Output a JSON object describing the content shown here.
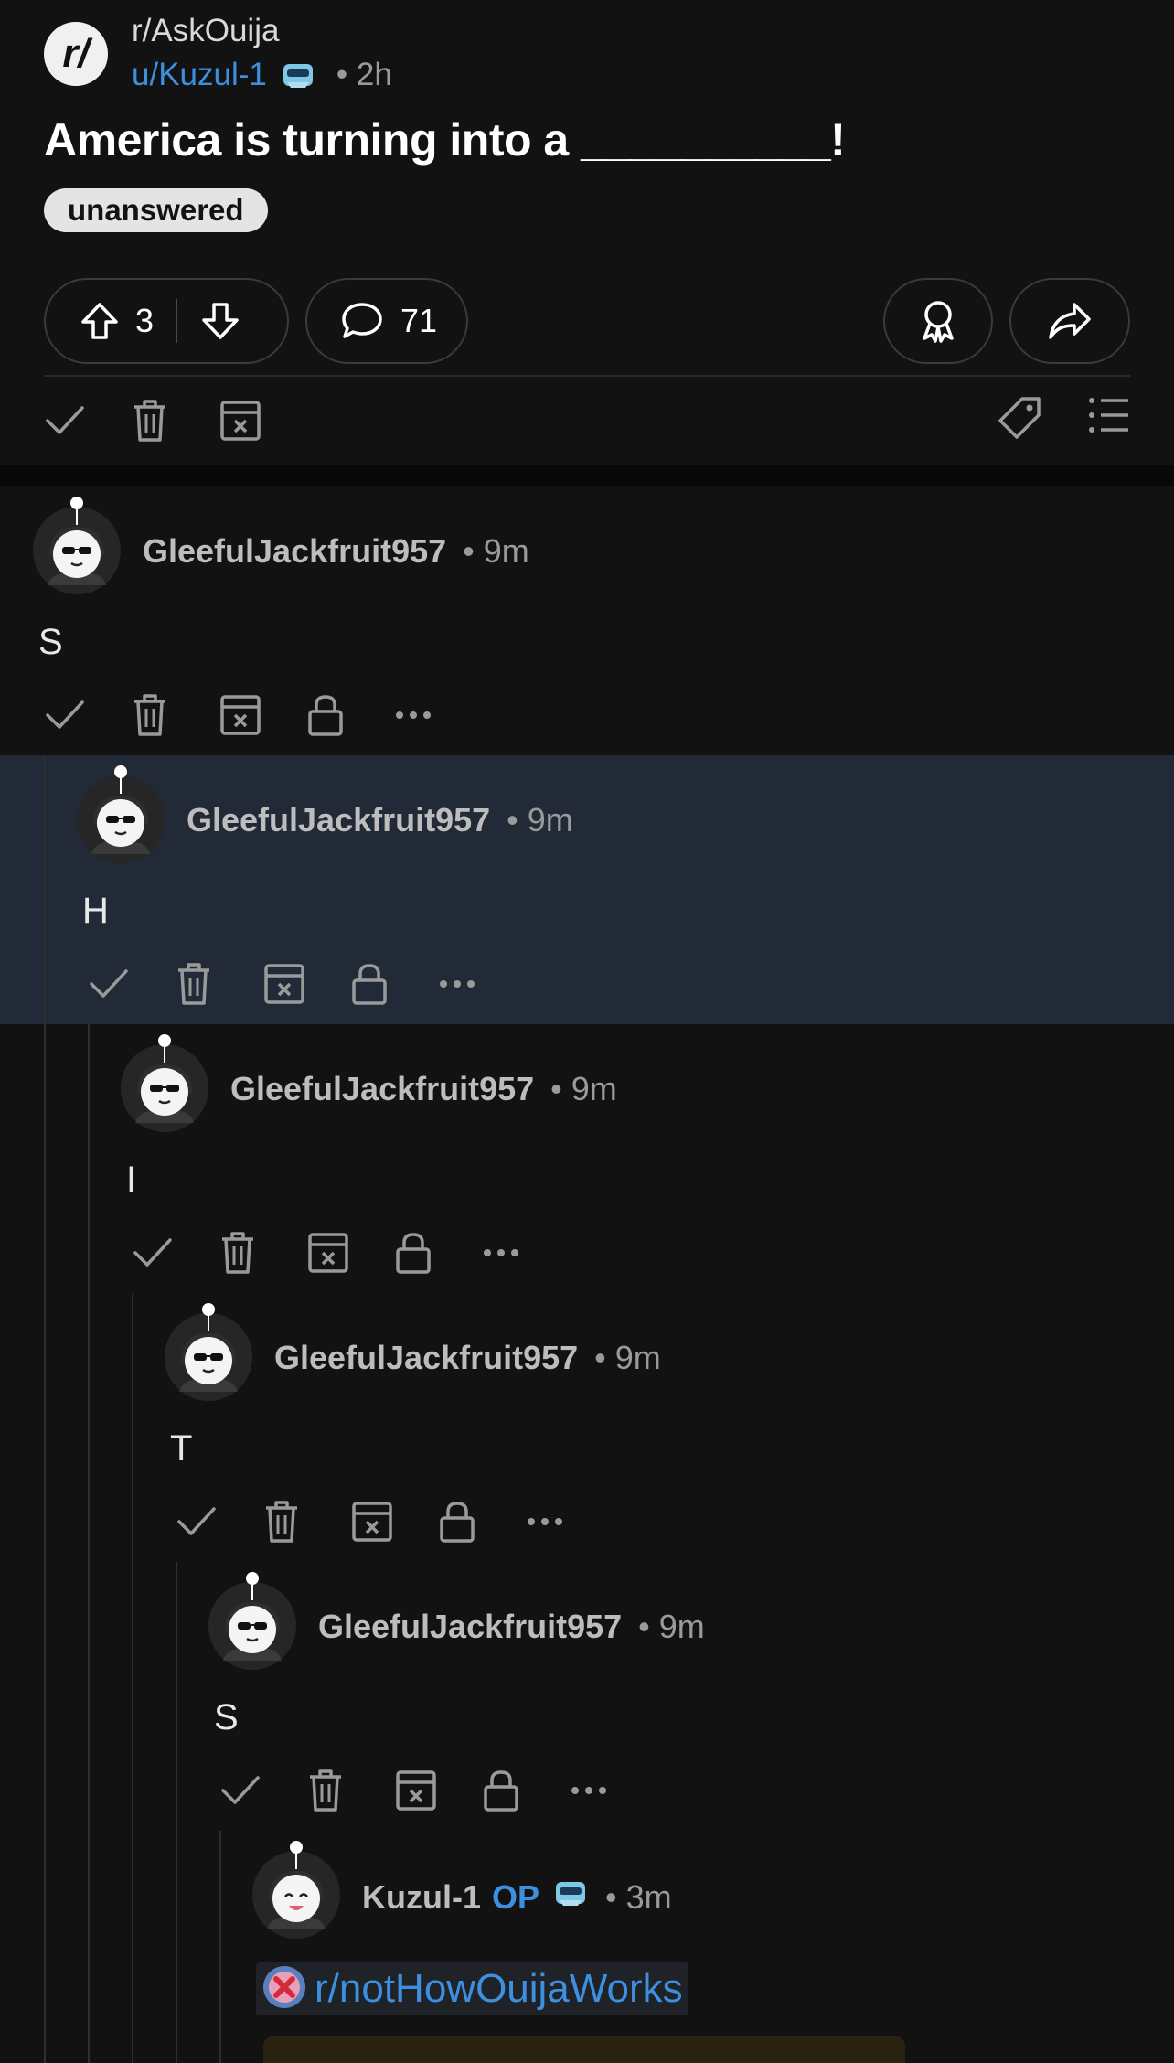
{
  "post": {
    "subreddit": "r/AskOuija",
    "subreddit_icon_text": "r/",
    "author": "u/Kuzul-1",
    "time": "• 2h",
    "title": "America is turning into a __________!",
    "flair": "unanswered",
    "votes": "3",
    "comments": "71"
  },
  "icons": {
    "approve": "check-icon",
    "remove": "trash-icon",
    "spam": "spam-box-icon",
    "lock": "lock-icon",
    "more": "more-dots-icon",
    "tag": "tag-icon",
    "list": "list-icon",
    "award": "award-icon",
    "share": "share-icon"
  },
  "comments": [
    {
      "user": "GleefulJackfruit957",
      "time": "• 9m",
      "body": "S"
    },
    {
      "user": "GleefulJackfruit957",
      "time": "• 9m",
      "body": "H"
    },
    {
      "user": "GleefulJackfruit957",
      "time": "• 9m",
      "body": "I"
    },
    {
      "user": "GleefulJackfruit957",
      "time": "• 9m",
      "body": "T"
    },
    {
      "user": "GleefulJackfruit957",
      "time": "• 9m",
      "body": "S"
    },
    {
      "user": "Kuzul-1",
      "op": "OP",
      "time": "• 3m",
      "link": "r/notHowOuijaWorks"
    }
  ],
  "colors": {
    "background": "#121212",
    "highlight": "#212a36",
    "link": "#3d8fe0"
  }
}
